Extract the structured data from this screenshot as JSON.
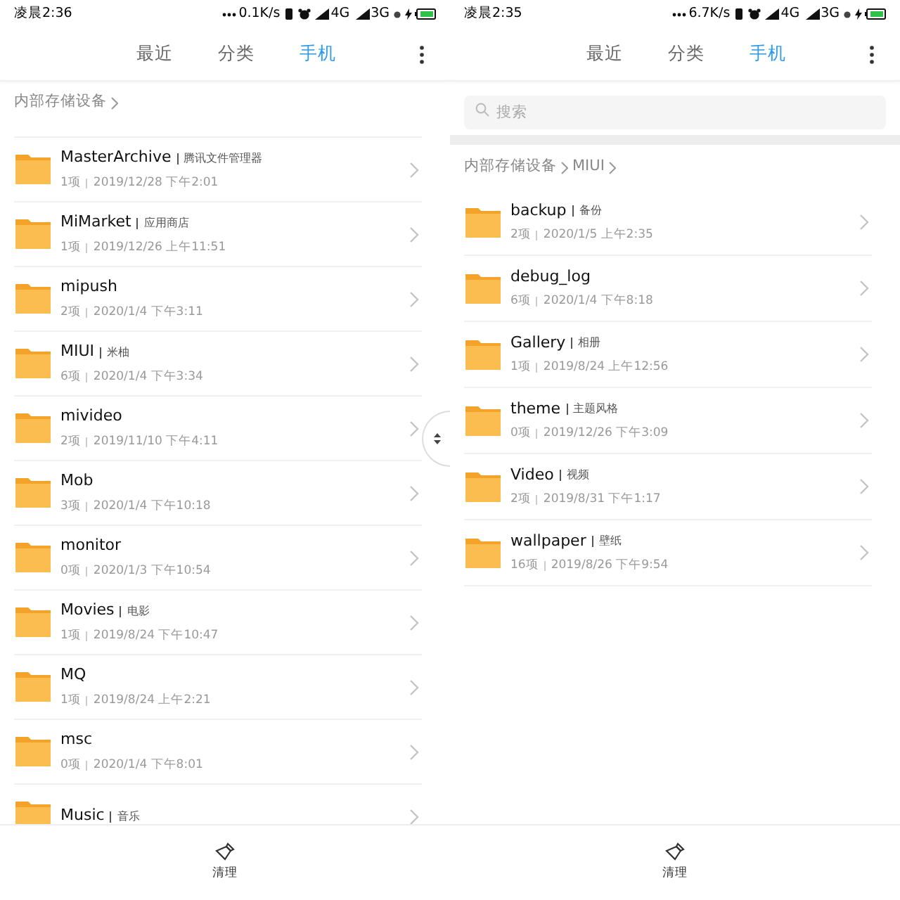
{
  "screens": [
    {
      "status_bar": {
        "time": "凌晨2:36",
        "speed": "0.1K/s",
        "network_1": "4G",
        "network_2": "3G"
      },
      "tabs": [
        {
          "label": "最近",
          "selected": false
        },
        {
          "label": "分类",
          "selected": false
        },
        {
          "label": "手机",
          "selected": true
        }
      ],
      "breadcrumb": [
        "内部存储设备"
      ],
      "fast_scroll_handle": true,
      "folders": [
        {
          "name": "MasterArchive",
          "tag": "腾讯文件管理器",
          "count": "1项",
          "date": "2019/12/28 下午2:01"
        },
        {
          "name": "MiMarket",
          "tag": "应用商店",
          "count": "1项",
          "date": "2019/12/26 上午11:51"
        },
        {
          "name": "mipush",
          "count": "2项",
          "date": "2020/1/4 下午3:11"
        },
        {
          "name": "MIUI",
          "tag": "米柚",
          "count": "6项",
          "date": "2020/1/4 下午3:34"
        },
        {
          "name": "mivideo",
          "count": "2项",
          "date": "2019/11/10 下午4:11"
        },
        {
          "name": "Mob",
          "count": "3项",
          "date": "2020/1/4 下午10:18"
        },
        {
          "name": "monitor",
          "count": "0项",
          "date": "2020/1/3 下午10:54"
        },
        {
          "name": "Movies",
          "tag": "电影",
          "count": "1项",
          "date": "2019/8/24 下午10:47"
        },
        {
          "name": "MQ",
          "count": "1项",
          "date": "2019/8/24 上午2:21"
        },
        {
          "name": "msc",
          "count": "0项",
          "date": "2020/1/4 下午8:01"
        },
        {
          "name": "Music",
          "tag": "音乐"
        }
      ],
      "bottom_action": "清理"
    },
    {
      "status_bar": {
        "time": "凌晨2:35",
        "speed": "6.7K/s",
        "network_1": "4G",
        "network_2": "3G"
      },
      "tabs": [
        {
          "label": "最近",
          "selected": false
        },
        {
          "label": "分类",
          "selected": false
        },
        {
          "label": "手机",
          "selected": true
        }
      ],
      "search": {
        "placeholder": "搜索"
      },
      "breadcrumb": [
        "内部存储设备",
        "MIUI"
      ],
      "folders": [
        {
          "name": "backup",
          "tag": "备份",
          "count": "2项",
          "date": "2020/1/5 上午2:35"
        },
        {
          "name": "debug_log",
          "count": "6项",
          "date": "2020/1/4 下午8:18"
        },
        {
          "name": "Gallery",
          "tag": "相册",
          "count": "1项",
          "date": "2019/8/24 上午12:56"
        },
        {
          "name": "theme",
          "tag": "主题风格",
          "count": "0项",
          "date": "2019/12/26 下午3:09"
        },
        {
          "name": "Video",
          "tag": "视频",
          "count": "2项",
          "date": "2019/8/31 下午1:17"
        },
        {
          "name": "wallpaper",
          "tag": "壁纸",
          "count": "16项",
          "date": "2019/8/26 下午9:54"
        }
      ],
      "bottom_action": "清理"
    }
  ]
}
